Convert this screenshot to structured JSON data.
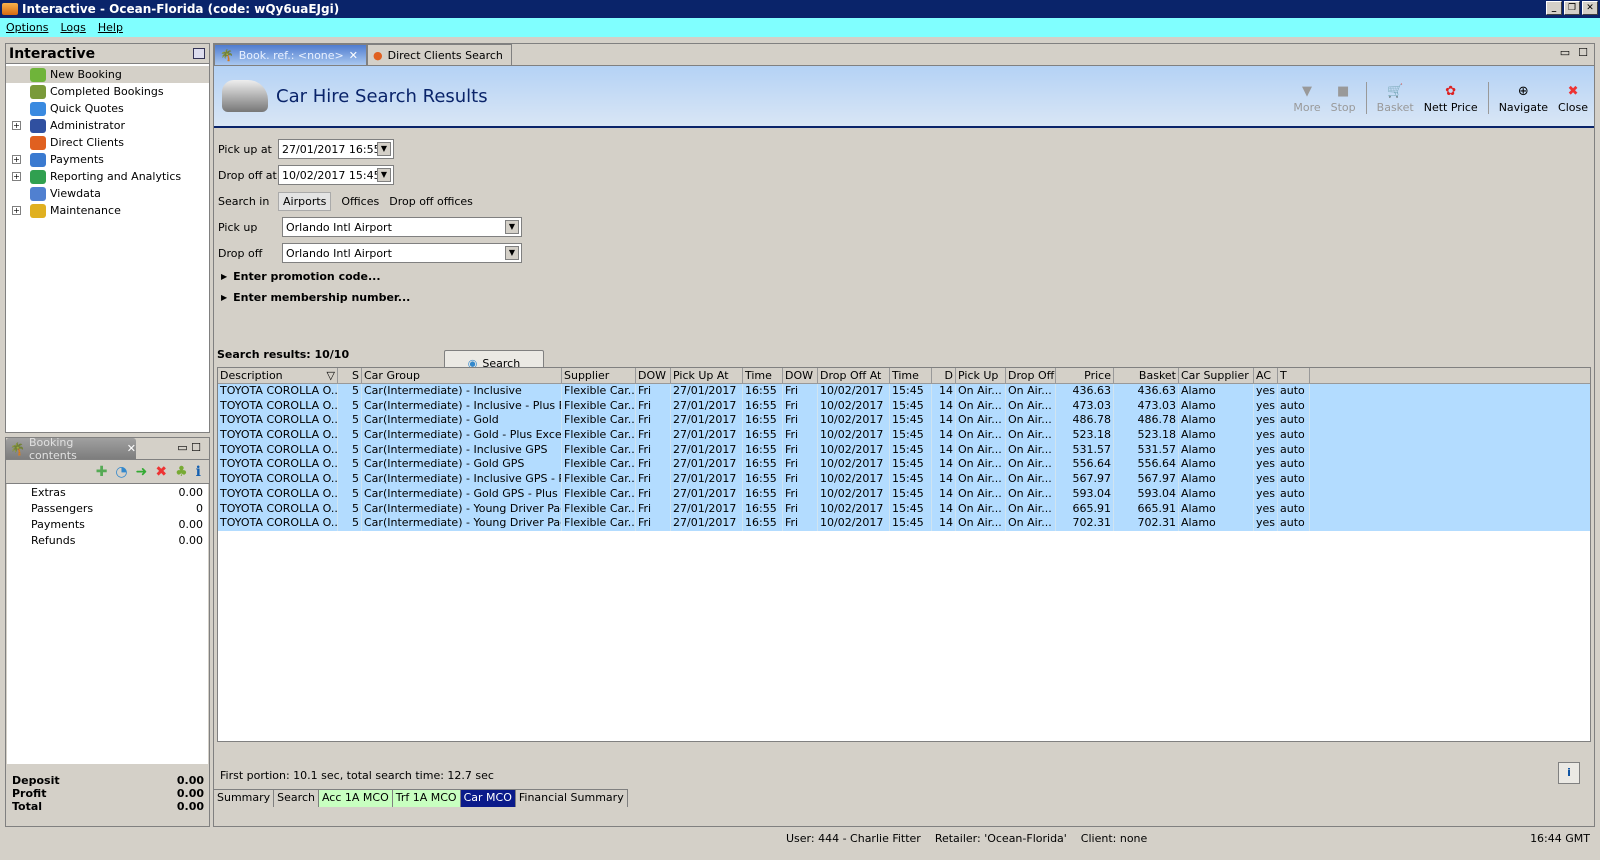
{
  "window": {
    "title": "Interactive - Ocean-Florida (code: wQy6uaEJgi)"
  },
  "menu": [
    "Options",
    "Logs",
    "Help"
  ],
  "nav": {
    "title": "Interactive",
    "items": [
      {
        "label": "New Booking",
        "expandable": false,
        "icon": "palm-tree-icon",
        "color": "#6fb43a"
      },
      {
        "label": "Completed Bookings",
        "expandable": false,
        "icon": "palm-money-icon",
        "color": "#7a9a3a"
      },
      {
        "label": "Quick Quotes",
        "expandable": false,
        "icon": "clock-icon",
        "color": "#3a8ae0"
      },
      {
        "label": "Administrator",
        "expandable": true,
        "icon": "running-man-icon",
        "color": "#3050a0"
      },
      {
        "label": "Direct Clients",
        "expandable": false,
        "icon": "person-icon",
        "color": "#e06020"
      },
      {
        "label": "Payments",
        "expandable": true,
        "icon": "payment-card-icon",
        "color": "#3a7ad0"
      },
      {
        "label": "Reporting and Analytics",
        "expandable": true,
        "icon": "report-icon",
        "color": "#30a050"
      },
      {
        "label": "Viewdata",
        "expandable": false,
        "icon": "globe-icon",
        "color": "#5080d0"
      },
      {
        "label": "Maintenance",
        "expandable": true,
        "icon": "toolbox-icon",
        "color": "#e0b020"
      }
    ]
  },
  "booking": {
    "tab": "Booking contents",
    "rows": [
      [
        "Extras",
        "0.00"
      ],
      [
        "Passengers",
        "0"
      ],
      [
        "Payments",
        "0.00"
      ],
      [
        "Refunds",
        "0.00"
      ]
    ],
    "totals": [
      [
        "Deposit",
        "0.00"
      ],
      [
        "Profit",
        "0.00"
      ],
      [
        "Total",
        "0.00"
      ]
    ]
  },
  "tabs": [
    {
      "label": "Book. ref.: <none>",
      "active": true
    },
    {
      "label": "Direct Clients Search",
      "active": false
    }
  ],
  "header": {
    "title": "Car Hire Search Results"
  },
  "tools": [
    {
      "label": "More",
      "g": "▼",
      "enabled": false
    },
    {
      "label": "Stop",
      "g": "■",
      "enabled": false
    },
    {
      "label": "Basket",
      "g": "🛒",
      "enabled": false
    },
    {
      "label": "Nett Price",
      "g": "✿",
      "enabled": true
    },
    {
      "label": "Navigate",
      "g": "⊕",
      "enabled": true
    },
    {
      "label": "Close",
      "g": "✖",
      "enabled": true
    }
  ],
  "form": {
    "pickup_at_label": "Pick up at",
    "pickup_at": "27/01/2017 16:55",
    "dropoff_at_label": "Drop off at",
    "dropoff_at": "10/02/2017 15:45",
    "search_in_label": "Search in",
    "search_in": [
      "Airports",
      "Offices",
      "Drop off offices"
    ],
    "pickup_label": "Pick up",
    "pickup": "Orlando Intl Airport",
    "dropoff_label": "Drop off",
    "dropoff": "Orlando Intl Airport",
    "promo": "Enter promotion code...",
    "membership": "Enter membership number...",
    "search": "Search"
  },
  "results": {
    "summary": "Search results: 10/10",
    "columns": [
      "Description",
      "S",
      "Car Group",
      "Supplier",
      "DOW",
      "Pick Up At",
      "Time",
      "DOW",
      "Drop Off At",
      "Time",
      "D",
      "Pick Up",
      "Drop Off",
      "Price",
      "Basket",
      "Car Supplier",
      "AC",
      "T"
    ],
    "rows": [
      [
        "TOYOTA COROLLA O...",
        "5",
        "Car(Intermediate) - Inclusive",
        "Flexible Car...",
        "Fri",
        "27/01/2017",
        "16:55",
        "Fri",
        "10/02/2017",
        "15:45",
        "14",
        "On Air...",
        "On Air...",
        "436.63",
        "436.63",
        "Alamo",
        "yes",
        "auto"
      ],
      [
        "TOYOTA COROLLA O...",
        "5",
        "Car(Intermediate) - Inclusive - Plus E...",
        "Flexible Car...",
        "Fri",
        "27/01/2017",
        "16:55",
        "Fri",
        "10/02/2017",
        "15:45",
        "14",
        "On Air...",
        "On Air...",
        "473.03",
        "473.03",
        "Alamo",
        "yes",
        "auto"
      ],
      [
        "TOYOTA COROLLA O...",
        "5",
        "Car(Intermediate) - Gold",
        "Flexible Car...",
        "Fri",
        "27/01/2017",
        "16:55",
        "Fri",
        "10/02/2017",
        "15:45",
        "14",
        "On Air...",
        "On Air...",
        "486.78",
        "486.78",
        "Alamo",
        "yes",
        "auto"
      ],
      [
        "TOYOTA COROLLA O...",
        "5",
        "Car(Intermediate) - Gold - Plus Exces...",
        "Flexible Car...",
        "Fri",
        "27/01/2017",
        "16:55",
        "Fri",
        "10/02/2017",
        "15:45",
        "14",
        "On Air...",
        "On Air...",
        "523.18",
        "523.18",
        "Alamo",
        "yes",
        "auto"
      ],
      [
        "TOYOTA COROLLA O...",
        "5",
        "Car(Intermediate) - Inclusive GPS",
        "Flexible Car...",
        "Fri",
        "27/01/2017",
        "16:55",
        "Fri",
        "10/02/2017",
        "15:45",
        "14",
        "On Air...",
        "On Air...",
        "531.57",
        "531.57",
        "Alamo",
        "yes",
        "auto"
      ],
      [
        "TOYOTA COROLLA O...",
        "5",
        "Car(Intermediate) - Gold GPS",
        "Flexible Car...",
        "Fri",
        "27/01/2017",
        "16:55",
        "Fri",
        "10/02/2017",
        "15:45",
        "14",
        "On Air...",
        "On Air...",
        "556.64",
        "556.64",
        "Alamo",
        "yes",
        "auto"
      ],
      [
        "TOYOTA COROLLA O...",
        "5",
        "Car(Intermediate) - Inclusive GPS - Pl...",
        "Flexible Car...",
        "Fri",
        "27/01/2017",
        "16:55",
        "Fri",
        "10/02/2017",
        "15:45",
        "14",
        "On Air...",
        "On Air...",
        "567.97",
        "567.97",
        "Alamo",
        "yes",
        "auto"
      ],
      [
        "TOYOTA COROLLA O...",
        "5",
        "Car(Intermediate) - Gold GPS - Plus E...",
        "Flexible Car...",
        "Fri",
        "27/01/2017",
        "16:55",
        "Fri",
        "10/02/2017",
        "15:45",
        "14",
        "On Air...",
        "On Air...",
        "593.04",
        "593.04",
        "Alamo",
        "yes",
        "auto"
      ],
      [
        "TOYOTA COROLLA O...",
        "5",
        "Car(Intermediate) - Young Driver Pac...",
        "Flexible Car...",
        "Fri",
        "27/01/2017",
        "16:55",
        "Fri",
        "10/02/2017",
        "15:45",
        "14",
        "On Air...",
        "On Air...",
        "665.91",
        "665.91",
        "Alamo",
        "yes",
        "auto"
      ],
      [
        "TOYOTA COROLLA O...",
        "5",
        "Car(Intermediate) - Young Driver Pac...",
        "Flexible Car...",
        "Fri",
        "27/01/2017",
        "16:55",
        "Fri",
        "10/02/2017",
        "15:45",
        "14",
        "On Air...",
        "On Air...",
        "702.31",
        "702.31",
        "Alamo",
        "yes",
        "auto"
      ]
    ]
  },
  "footer": {
    "timing": "First portion: 10.1 sec, total search time: 12.7 sec"
  },
  "bottom_tabs": [
    {
      "label": "Summary",
      "bg": "#d4d0c8",
      "fg": "#000000"
    },
    {
      "label": "Search",
      "bg": "#d4d0c8",
      "fg": "#000000"
    },
    {
      "label": "Acc 1A MCO",
      "bg": "#c8ffc0",
      "fg": "#000000"
    },
    {
      "label": "Trf 1A MCO",
      "bg": "#c8ffc0",
      "fg": "#000000"
    },
    {
      "label": "Car MCO",
      "bg": "#0a1a8a",
      "fg": "#ffffff"
    },
    {
      "label": "Financial Summary",
      "bg": "#d4d0c8",
      "fg": "#000000"
    }
  ],
  "status": {
    "user": "User: 444 - Charlie Fitter    Retailer: 'Ocean-Florida'    Client: none",
    "time": "16:44 GMT"
  }
}
